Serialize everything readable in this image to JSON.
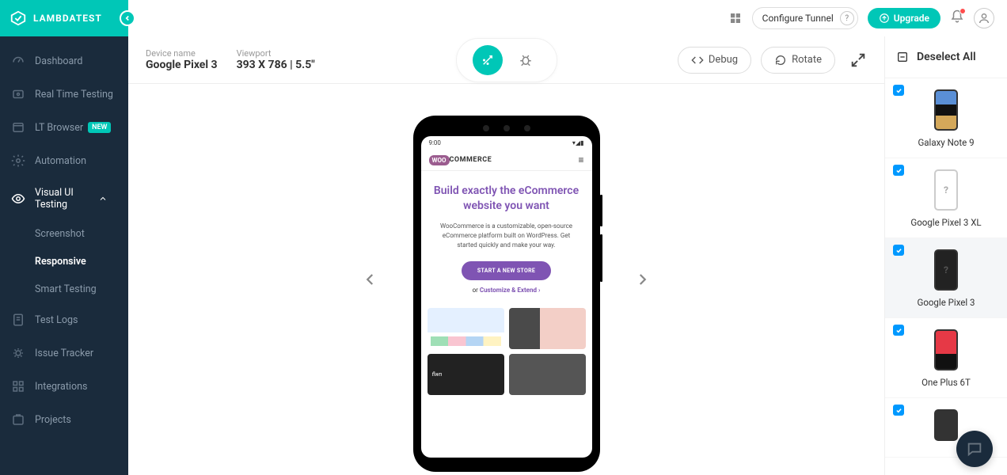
{
  "brand": {
    "name": "LAMBDATEST"
  },
  "topbar": {
    "configure_tunnel": "Configure Tunnel",
    "configure_help": "?",
    "upgrade": "Upgrade"
  },
  "sidebar": {
    "items": [
      {
        "label": "Dashboard"
      },
      {
        "label": "Real Time Testing"
      },
      {
        "label": "LT Browser",
        "badge": "NEW"
      },
      {
        "label": "Automation"
      },
      {
        "label": "Visual UI Testing",
        "open": true
      },
      {
        "label": "Test Logs"
      },
      {
        "label": "Issue Tracker"
      },
      {
        "label": "Integrations"
      },
      {
        "label": "Projects"
      }
    ],
    "sub_items": [
      {
        "label": "Screenshot"
      },
      {
        "label": "Responsive",
        "active": true
      },
      {
        "label": "Smart Testing"
      }
    ]
  },
  "viewer": {
    "device_name_label": "Device name",
    "device_name_value": "Google Pixel 3",
    "viewport_label": "Viewport",
    "viewport_value": "393 X 786 | 5.5\"",
    "debug": "Debug",
    "rotate": "Rotate"
  },
  "device_panel": {
    "deselect_all": "Deselect All",
    "devices": [
      {
        "name": "Galaxy Note 9",
        "checked": true,
        "thumb": "note9"
      },
      {
        "name": "Google Pixel 3 XL",
        "checked": true,
        "thumb": "pixel3xl"
      },
      {
        "name": "Google Pixel 3",
        "checked": true,
        "thumb": "pixel3",
        "selected": true
      },
      {
        "name": "One Plus 6T",
        "checked": true,
        "thumb": "oneplus"
      },
      {
        "name": "",
        "checked": true,
        "thumb": "generic"
      }
    ]
  },
  "phone_content": {
    "time": "9:00",
    "brand_bubble": "WOO",
    "brand_text": "COMMERCE",
    "hero_title": "Build exactly the eCommerce website you want",
    "hero_sub": "WooCommerce is a customizable, open-source eCommerce platform built on WordPress. Get started quickly and make your way.",
    "cta": "START A NEW STORE",
    "cta_sub_prefix": "or ",
    "cta_sub_link": "Customize & Extend ›",
    "tile_text": "flwn"
  },
  "colors": {
    "accent": "#00c7b7",
    "sidebar_bg": "#1a2b3c",
    "purple": "#7f54b3"
  }
}
